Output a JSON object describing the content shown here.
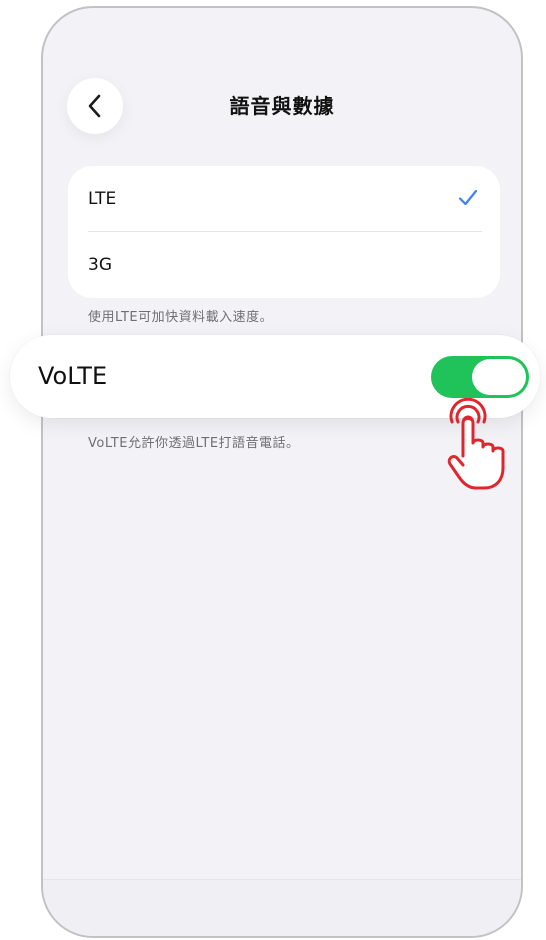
{
  "nav": {
    "back_icon": "chevron-left-icon",
    "title": "語音與數據"
  },
  "network_options": [
    {
      "label": "LTE",
      "selected": true
    },
    {
      "label": "3G",
      "selected": false
    }
  ],
  "network_footnote": "使用LTE可加快資料載入速度。",
  "volte": {
    "label": "VoLTE",
    "enabled": true,
    "footnote": "VoLTE允許你透過LTE打語音電話。"
  },
  "colors": {
    "accent_check": "#3b82f6",
    "toggle_on": "#1fc35a",
    "tap_indicator": "#e0262d",
    "background": "#f2f2f7"
  },
  "annotation": {
    "icon": "tap-hand-icon"
  }
}
